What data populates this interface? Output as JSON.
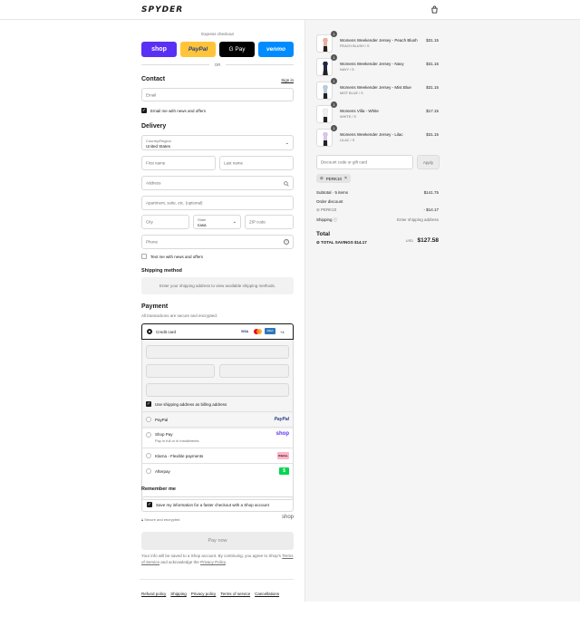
{
  "header": {
    "logo": "SPYDER",
    "cart_icon": "bag-icon"
  },
  "express": {
    "label": "Express checkout",
    "buttons": [
      {
        "label": "shop",
        "bg": "#5a31f4",
        "fg": "#ffffff"
      },
      {
        "label": "PayPal",
        "bg": "#ffc439",
        "fg": "#253b80"
      },
      {
        "label": "G Pay",
        "bg": "#000000",
        "fg": "#ffffff"
      },
      {
        "label": "venmo",
        "bg": "#008cff",
        "fg": "#ffffff"
      }
    ],
    "or": "OR"
  },
  "contact": {
    "title": "Contact",
    "sign_in": "Sign in",
    "email_placeholder": "Email",
    "news_label": "Email me with news and offers"
  },
  "delivery": {
    "title": "Delivery",
    "country_label": "Country/Region",
    "country_value": "United States",
    "first_name": "First name",
    "last_name": "Last name",
    "address": "Address",
    "apartment": "Apartment, suite, etc. (optional)",
    "city": "City",
    "state_label": "State",
    "state_value": "Iowa",
    "zip": "ZIP code",
    "phone": "Phone",
    "text_label": "Text me with news and offers"
  },
  "shipping_method": {
    "title": "Shipping method",
    "notice": "Enter your shipping address to view available shipping methods."
  },
  "payment": {
    "title": "Payment",
    "subtitle": "All transactions are secure and encrypted.",
    "credit_card": "Credit card",
    "card_brands": [
      "VISA",
      "MC",
      "AMEX"
    ],
    "more_brands": "+4",
    "billing_label": "Use shipping address as billing address",
    "methods": [
      {
        "label": "PayPal",
        "sub": "",
        "logo": "PayPal"
      },
      {
        "label": "Shop Pay",
        "sub": "Pay in full or in installments",
        "logo": "shop"
      },
      {
        "label": "Klarna - Flexible payments",
        "sub": "",
        "logo": "Klarna."
      },
      {
        "label": "Afterpay",
        "sub": "",
        "logo": "$"
      }
    ]
  },
  "remember": {
    "title": "Remember me",
    "label": "Save my information for a faster checkout with a Shop account",
    "secure": "Secure and encrypted",
    "shop": "shop"
  },
  "pay_now": "Pay now",
  "disclaimer": {
    "text1": "Your info will be saved to a Shop account. By continuing, you agree to Shop's",
    "terms": "Terms of Service",
    "and": "and acknowledge the",
    "privacy": "Privacy Policy",
    "end": "."
  },
  "footer_links": [
    "Refund policy",
    "Shipping",
    "Privacy policy",
    "Terms of service",
    "Cancellations"
  ],
  "cart": {
    "items": [
      {
        "qty": "1",
        "name": "Womens Weekender Jersey - Peach Blush",
        "variant": "PEACH BLUSH / S",
        "price": "$31.15"
      },
      {
        "qty": "1",
        "name": "Womens Weekender Jersey - Navy",
        "variant": "NAVY / S",
        "price": "$31.15"
      },
      {
        "qty": "1",
        "name": "Womens Weekender Jersey - Mist Blue",
        "variant": "MIST BLUE / S",
        "price": "$31.15"
      },
      {
        "qty": "1",
        "name": "Womens Villa - White",
        "variant": "WHITE / S",
        "price": "$17.15"
      },
      {
        "qty": "1",
        "name": "Womens Weekender Jersey - Lilac",
        "variant": "LILAC / S",
        "price": "$31.15"
      }
    ],
    "discount_placeholder": "Discount code or gift card",
    "apply": "Apply",
    "code": "PERK10",
    "subtotal_label": "Subtotal · 5 items",
    "subtotal": "$141.75",
    "order_discount": "Order discount",
    "discount_code": "PERK10",
    "discount_amount": "- $14.17",
    "shipping_label": "Shipping",
    "shipping_value": "Enter shipping address",
    "total_label": "Total",
    "currency": "USD",
    "total": "$127.58",
    "savings_label": "TOTAL SAVINGS",
    "savings": "$14.17"
  }
}
